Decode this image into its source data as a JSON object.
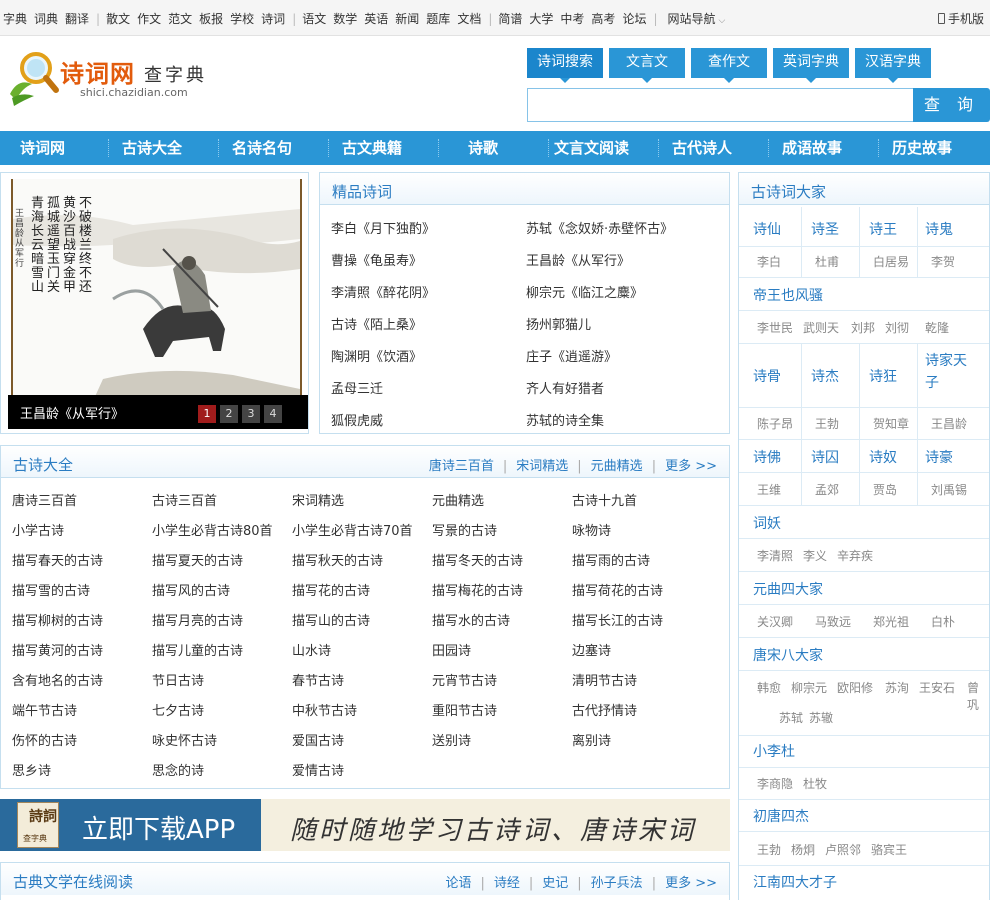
{
  "topbar": {
    "links": [
      "字典",
      "词典",
      "翻译",
      "散文",
      "作文",
      "范文",
      "板报",
      "学校",
      "诗词",
      "语文",
      "数学",
      "英语",
      "新闻",
      "题库",
      "文档",
      "简谱",
      "大学",
      "中考",
      "高考",
      "论坛"
    ],
    "separator": "|",
    "site_nav": "网站导航",
    "mobile": "手机版"
  },
  "logo": {
    "title": "诗词网",
    "sub": "查字典",
    "domain": "shici.chazidian.com"
  },
  "search": {
    "tabs": [
      "诗词搜索",
      "文言文",
      "查作文",
      "英词字典",
      "汉语字典"
    ],
    "active_tab": "诗词搜索",
    "input_value": "",
    "button": "查 询"
  },
  "main_nav": [
    "诗词网",
    "古诗大全",
    "名诗名句",
    "古文典籍",
    "诗歌",
    "文言文阅读",
    "古代诗人",
    "成语故事",
    "历史故事"
  ],
  "slideshow": {
    "caption": "王昌龄《从军行》",
    "pages": [
      "1",
      "2",
      "3",
      "4"
    ],
    "active_page": "1",
    "poem_lines": [
      "青海长云暗雪山",
      "孤城遥望玉门关",
      "黄沙百战穿金甲",
      "不破楼兰终不还"
    ],
    "poem_sign": "王昌龄从军行"
  },
  "featured": {
    "title": "精品诗词",
    "items": [
      "李白《月下独酌》",
      "苏轼《念奴娇·赤壁怀古》",
      "曹操《龟虽寿》",
      "王昌龄《从军行》",
      "李清照《醉花阴》",
      "柳宗元《临江之麋》",
      "古诗《陌上桑》",
      "扬州郭猫儿",
      "陶渊明《饮酒》",
      "庄子《逍遥游》",
      "孟母三迁",
      "齐人有好猎者",
      "狐假虎威",
      "苏轼的诗全集"
    ]
  },
  "gushi": {
    "title": "古诗大全",
    "links": [
      "唐诗三百首",
      "宋词精选",
      "元曲精选"
    ],
    "more": "更多 >>",
    "items": [
      "唐诗三百首",
      "古诗三百首",
      "宋词精选",
      "元曲精选",
      "古诗十九首",
      "小学古诗",
      "小学生必背古诗80首",
      "小学生必背古诗70首",
      "写景的古诗",
      "咏物诗",
      "描写春天的古诗",
      "描写夏天的古诗",
      "描写秋天的古诗",
      "描写冬天的古诗",
      "描写雨的古诗",
      "描写雪的古诗",
      "描写风的古诗",
      "描写花的古诗",
      "描写梅花的古诗",
      "描写荷花的古诗",
      "描写柳树的古诗",
      "描写月亮的古诗",
      "描写山的古诗",
      "描写水的古诗",
      "描写长江的古诗",
      "描写黄河的古诗",
      "描写儿童的古诗",
      "山水诗",
      "田园诗",
      "边塞诗",
      "含有地名的古诗",
      "节日古诗",
      "春节古诗",
      "元宵节古诗",
      "清明节古诗",
      "端午节古诗",
      "七夕古诗",
      "中秋节古诗",
      "重阳节古诗",
      "古代抒情诗",
      "伤怀的古诗",
      "咏史怀古诗",
      "爱国古诗",
      "送别诗",
      "离别诗",
      "思乡诗",
      "思念的诗",
      "爱情古诗"
    ]
  },
  "app_banner": {
    "left_text": "立即下载APP",
    "icon_text": "詩詞",
    "icon_sub": "查字典",
    "slogan": "随时随地学习古诗词、唐诗宋词"
  },
  "classics": {
    "title": "古典文学在线阅读",
    "links": [
      "论语",
      "诗经",
      "史记",
      "孙子兵法"
    ],
    "more": "更多 >>"
  },
  "poets": {
    "title": "古诗词大家",
    "grid1": {
      "cats": [
        "诗仙",
        "诗圣",
        "诗王",
        "诗鬼"
      ],
      "names": [
        "李白",
        "杜甫",
        "白居易",
        "李贺"
      ]
    },
    "group1": {
      "title": "帝王也风骚",
      "names": [
        "李世民",
        "武则天",
        "刘邦",
        "刘彻",
        "乾隆"
      ]
    },
    "grid2": {
      "cats": [
        "诗骨",
        "诗杰",
        "诗狂",
        "诗家天子"
      ],
      "names": [
        "陈子昂",
        "王勃",
        "贺知章",
        "王昌龄"
      ]
    },
    "grid3": {
      "cats": [
        "诗佛",
        "诗囚",
        "诗奴",
        "诗豪"
      ],
      "names": [
        "王维",
        "孟郊",
        "贾岛",
        "刘禹锡"
      ]
    },
    "group2": {
      "title": "词妖",
      "names": [
        "李清照",
        "李义",
        "辛弃疾"
      ]
    },
    "group3": {
      "title": "元曲四大家",
      "names": [
        "关汉卿",
        "马致远",
        "郑光祖",
        "白朴"
      ]
    },
    "group4": {
      "title": "唐宋八大家",
      "names": [
        "韩愈",
        "柳宗元",
        "欧阳修",
        "苏洵",
        "王安石",
        "曾巩",
        "苏轼",
        "苏辙"
      ]
    },
    "group5": {
      "title": "小李杜",
      "names": [
        "李商隐",
        "杜牧"
      ]
    },
    "group6": {
      "title": "初唐四杰",
      "names": [
        "王勃",
        "杨炯",
        "卢照邻",
        "骆宾王"
      ]
    },
    "group7": {
      "title": "江南四大才子"
    }
  },
  "colors": {
    "brand_blue": "#2a96d6",
    "title_blue": "#2a7cc2",
    "logo_orange": "#e25b0c",
    "slide_active": "#a01c1c"
  }
}
